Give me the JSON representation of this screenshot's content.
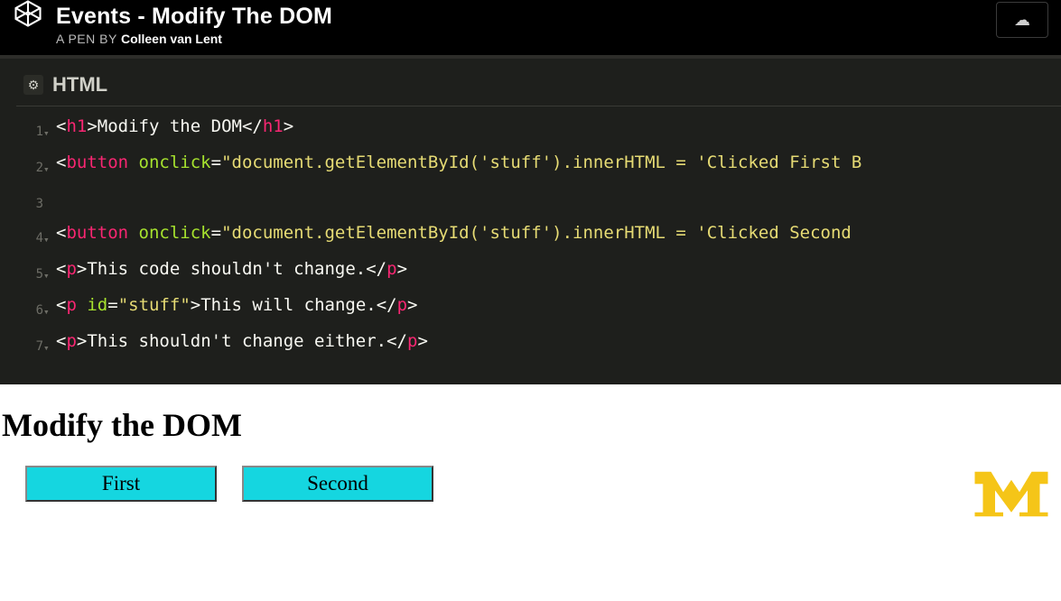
{
  "header": {
    "page_title": "Events - Modify The DOM",
    "pen_by_prefix": "A PEN BY ",
    "author": "Colleen van Lent"
  },
  "editor": {
    "lang_label": "HTML",
    "lines": [
      {
        "n": "1",
        "fold": "▾",
        "tokens": [
          {
            "c": "ang",
            "t": "<"
          },
          {
            "c": "tag",
            "t": "h1"
          },
          {
            "c": "ang",
            "t": ">"
          },
          {
            "c": "txt",
            "t": "Modify the DOM"
          },
          {
            "c": "ang",
            "t": "</"
          },
          {
            "c": "tag",
            "t": "h1"
          },
          {
            "c": "ang",
            "t": ">"
          }
        ]
      },
      {
        "n": "2",
        "fold": "▾",
        "tokens": [
          {
            "c": "ang",
            "t": "<"
          },
          {
            "c": "tag",
            "t": "button"
          },
          {
            "c": "txt",
            "t": " "
          },
          {
            "c": "attr",
            "t": "onclick"
          },
          {
            "c": "eq",
            "t": "="
          },
          {
            "c": "str",
            "t": "\"document.getElementById('stuff').innerHTML = 'Clicked First B"
          }
        ]
      },
      {
        "n": "3",
        "fold": "",
        "tokens": []
      },
      {
        "n": "4",
        "fold": "▾",
        "tokens": [
          {
            "c": "ang",
            "t": "<"
          },
          {
            "c": "tag",
            "t": "button"
          },
          {
            "c": "txt",
            "t": " "
          },
          {
            "c": "attr",
            "t": "onclick"
          },
          {
            "c": "eq",
            "t": "="
          },
          {
            "c": "str",
            "t": "\"document.getElementById('stuff').innerHTML = 'Clicked Second "
          }
        ]
      },
      {
        "n": "5",
        "fold": "▾",
        "tokens": [
          {
            "c": "ang",
            "t": "<"
          },
          {
            "c": "tag",
            "t": "p"
          },
          {
            "c": "ang",
            "t": ">"
          },
          {
            "c": "txt",
            "t": "This code shouldn't change."
          },
          {
            "c": "ang",
            "t": "</"
          },
          {
            "c": "tag",
            "t": "p"
          },
          {
            "c": "ang",
            "t": ">"
          }
        ]
      },
      {
        "n": "6",
        "fold": "▾",
        "tokens": [
          {
            "c": "ang",
            "t": "<"
          },
          {
            "c": "tag",
            "t": "p"
          },
          {
            "c": "txt",
            "t": " "
          },
          {
            "c": "attr",
            "t": "id"
          },
          {
            "c": "eq",
            "t": "="
          },
          {
            "c": "str",
            "t": "\"stuff\""
          },
          {
            "c": "ang",
            "t": ">"
          },
          {
            "c": "txt",
            "t": "This will change."
          },
          {
            "c": "ang",
            "t": "</"
          },
          {
            "c": "tag",
            "t": "p"
          },
          {
            "c": "ang",
            "t": ">"
          }
        ]
      },
      {
        "n": "7",
        "fold": "▾",
        "tokens": [
          {
            "c": "ang",
            "t": "<"
          },
          {
            "c": "tag",
            "t": "p"
          },
          {
            "c": "ang",
            "t": ">"
          },
          {
            "c": "txt",
            "t": "This shouldn't change either."
          },
          {
            "c": "ang",
            "t": "</"
          },
          {
            "c": "tag",
            "t": "p"
          },
          {
            "c": "ang",
            "t": ">"
          }
        ]
      }
    ]
  },
  "preview": {
    "heading": "Modify the DOM",
    "buttons": {
      "first": "First",
      "second": "Second"
    }
  }
}
